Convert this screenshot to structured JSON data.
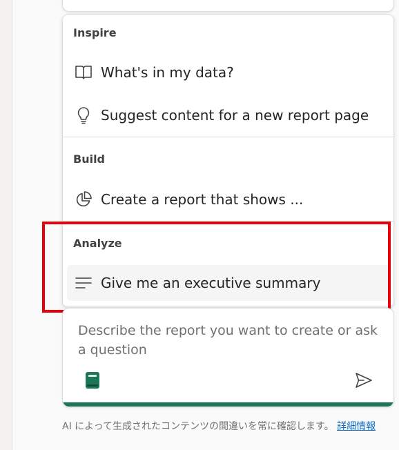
{
  "menu": {
    "sections": [
      {
        "header": "Inspire",
        "items": [
          {
            "label": "What's in my data?",
            "icon": "book-open-icon"
          },
          {
            "label": "Suggest content for a new report page",
            "icon": "lightbulb-icon"
          }
        ]
      },
      {
        "header": "Build",
        "items": [
          {
            "label": "Create a report that shows ...",
            "icon": "pie-chart-icon"
          }
        ]
      },
      {
        "header": "Analyze",
        "items": [
          {
            "label": "Give me an executive summary",
            "icon": "text-lines-icon"
          }
        ]
      }
    ]
  },
  "input": {
    "placeholder": "Describe the report you want to create or ask a question"
  },
  "disclaimer": {
    "text": "AI によって生成されたコンテンツの間違いを常に確認します。",
    "link": "詳細情報"
  },
  "colors": {
    "accent": "#1b7556",
    "highlight": "#e8000b",
    "link": "#0f6cbd"
  }
}
